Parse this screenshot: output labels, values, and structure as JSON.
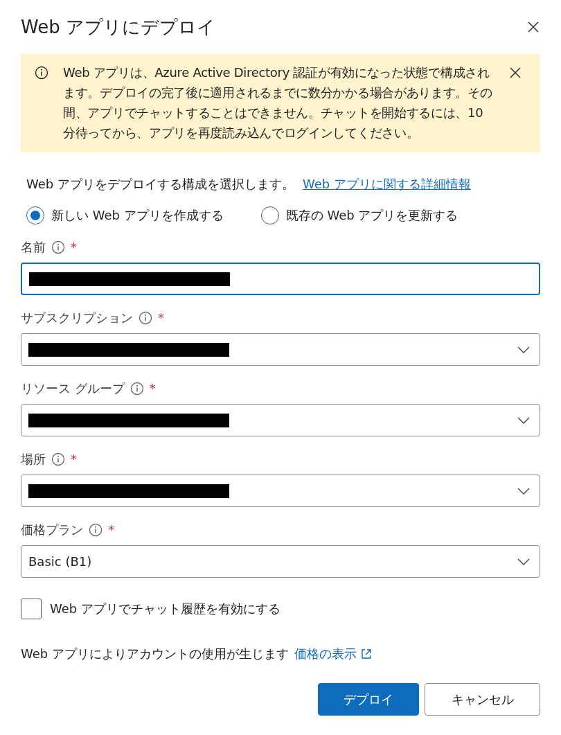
{
  "dialog": {
    "title": "Web アプリにデプロイ"
  },
  "warning": {
    "text": "Web アプリは、Azure Active Directory 認証が有効になった状態で構成されます。デプロイの完了後に適用されるまでに数分かかる場合があります。その間、アプリでチャットすることはできません。チャットを開始するには、10 分待ってから、アプリを再度読み込んでログインしてください。"
  },
  "intro": {
    "text": "Web アプリをデプロイする構成を選択します。",
    "link": "Web アプリに関する詳細情報"
  },
  "options": [
    {
      "label": "新しい Web アプリを作成する",
      "selected": true
    },
    {
      "label": "既存の Web アプリを更新する",
      "selected": false
    }
  ],
  "fields": [
    {
      "label": "名前",
      "required_mark": "*",
      "kind": "text",
      "focused": true,
      "redacted": true
    },
    {
      "label": "サブスクリプション",
      "required_mark": "*",
      "kind": "dropdown",
      "focused": false,
      "redacted": true
    },
    {
      "label": "リソース グループ",
      "required_mark": "*",
      "kind": "dropdown",
      "focused": false,
      "redacted": true
    },
    {
      "label": "場所",
      "required_mark": "*",
      "kind": "dropdown",
      "focused": false,
      "redacted": true
    },
    {
      "label": "価格プラン",
      "required_mark": "*",
      "kind": "dropdown",
      "focused": false,
      "redacted": false,
      "value": "Basic (B1)"
    }
  ],
  "chat_history": {
    "label": "Web アプリでチャット履歴を有効にする",
    "checked": false
  },
  "cost_note": {
    "text": "Web アプリによりアカウントの使用が生じます",
    "link": "価格の表示"
  },
  "buttons": [
    {
      "label": "デプロイ",
      "kind": "primary"
    },
    {
      "label": "キャンセル",
      "kind": "secondary"
    }
  ]
}
